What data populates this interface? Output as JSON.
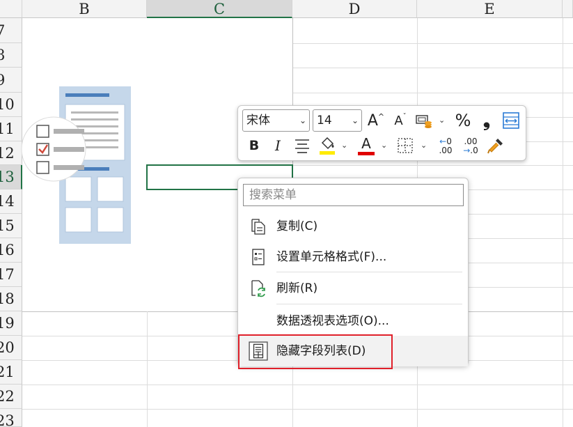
{
  "columns": [
    "B",
    "C",
    "D",
    "E"
  ],
  "rows": [
    "7",
    "8",
    "9",
    "10",
    "11",
    "12",
    "13",
    "14",
    "15",
    "16",
    "17",
    "18",
    "19",
    "20",
    "21",
    "22",
    "23"
  ],
  "mini_toolbar": {
    "font_name": "宋体",
    "font_size": "14",
    "bold": "B",
    "italic": "I",
    "percent": "%",
    "comma": "❟",
    "font_color_letter": "A",
    "grow_font": "A",
    "shrink_font": "A",
    "decrease_decimal_top": "0",
    "decrease_decimal_bottom": ".00",
    "increase_decimal_top": ".00",
    "increase_decimal_bottom": ".0"
  },
  "context_menu": {
    "search_placeholder": "搜索菜单",
    "items": [
      {
        "label": "复制(C)",
        "icon": "copy-icon"
      },
      {
        "label": "设置单元格格式(F)...",
        "icon": "format-cells-icon"
      },
      {
        "label": "刷新(R)",
        "icon": "refresh-icon"
      },
      {
        "label": "数据透视表选项(O)...",
        "icon": ""
      },
      {
        "label": "隐藏字段列表(D)",
        "icon": "field-list-icon"
      }
    ]
  },
  "colors": {
    "selection_green": "#217346",
    "highlight_red": "#e0202a",
    "fill_yellow": "#ffeb00",
    "font_red": "#e00000",
    "illustration_blue": "#c5d7ea",
    "illustration_dark_blue": "#4a7ebb"
  }
}
